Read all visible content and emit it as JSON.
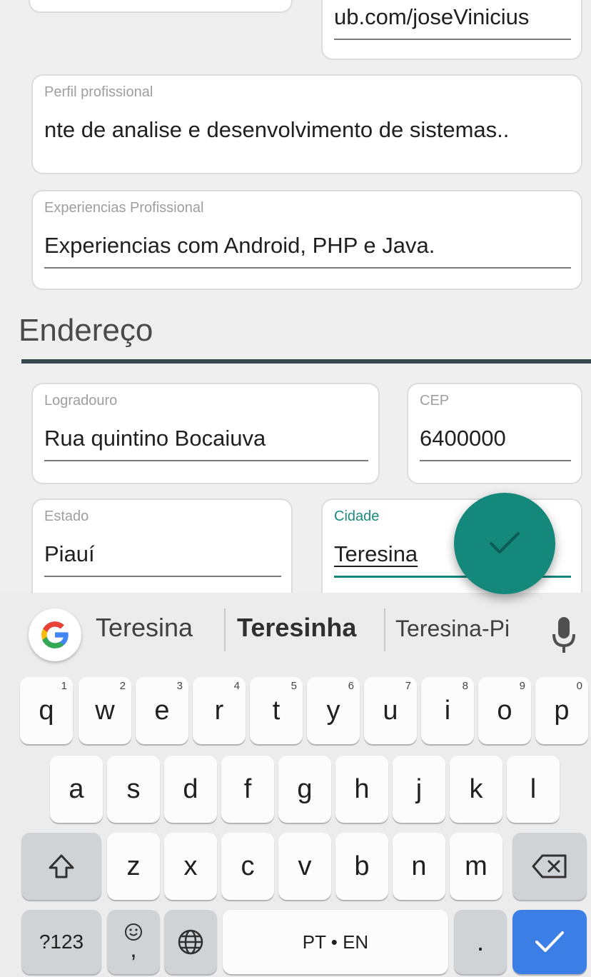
{
  "form": {
    "github": {
      "value": "ub.com/joseVinicius"
    },
    "perfil": {
      "label": "Perfil profissional",
      "value": "nte de analise e desenvolvimento de sistemas.."
    },
    "experiencias": {
      "label": "Experiencias Profissional",
      "value": "Experiencias com Android, PHP e Java."
    },
    "section_title": "Endereço",
    "logradouro": {
      "label": "Logradouro",
      "value": "Rua quintino Bocaiuva"
    },
    "cep": {
      "label": "CEP",
      "value": "6400000"
    },
    "estado": {
      "label": "Estado",
      "value": "Piauí"
    },
    "cidade": {
      "label": "Cidade",
      "value": "Teresina"
    },
    "fab_icon": "check-icon",
    "accent_color": "#15887c"
  },
  "keyboard": {
    "suggestions": [
      "Teresina",
      "Teresinha",
      "Teresina-Pi"
    ],
    "row1": [
      {
        "k": "q",
        "h": "1"
      },
      {
        "k": "w",
        "h": "2"
      },
      {
        "k": "e",
        "h": "3"
      },
      {
        "k": "r",
        "h": "4"
      },
      {
        "k": "t",
        "h": "5"
      },
      {
        "k": "y",
        "h": "6"
      },
      {
        "k": "u",
        "h": "7"
      },
      {
        "k": "i",
        "h": "8"
      },
      {
        "k": "o",
        "h": "9"
      },
      {
        "k": "p",
        "h": "0"
      }
    ],
    "row2": [
      "a",
      "s",
      "d",
      "f",
      "g",
      "h",
      "j",
      "k",
      "l"
    ],
    "row3": [
      "z",
      "x",
      "c",
      "v",
      "b",
      "n",
      "m"
    ],
    "symbols_label": "?123",
    "emoji_comma_label": ",",
    "space_label": "PT • EN",
    "period_label": ".",
    "enter_color": "#3a7ee6"
  }
}
